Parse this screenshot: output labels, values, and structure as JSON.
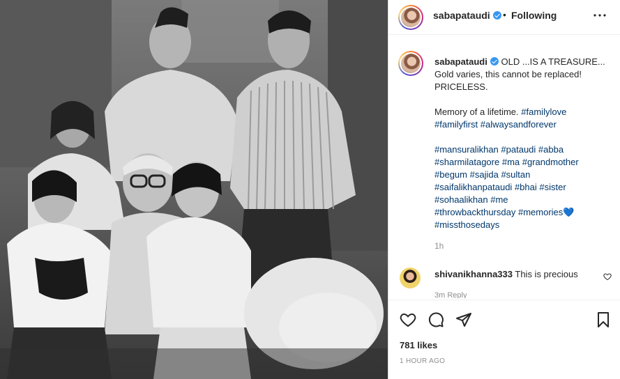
{
  "header": {
    "username": "sabapataudi",
    "separator": "•",
    "follow_status": "Following",
    "more_label": "•••"
  },
  "caption": {
    "username": "sabapataudi",
    "line1_rest": "OLD ...IS A TREASURE...",
    "line2": "Gold varies, this cannot be replaced!",
    "line3": "PRICELESS.",
    "line4_text": "Memory of a lifetime.",
    "tags_line4": [
      "#familylove"
    ],
    "tags_line5": [
      "#familyfirst",
      "#alwaysandforever"
    ],
    "tags_line6": [
      "#mansuralikhan",
      "#pataudi",
      "#abba"
    ],
    "tags_line7": [
      "#sharmilatagore",
      "#ma",
      "#grandmother"
    ],
    "tags_line8": [
      "#begum",
      "#sajida",
      "#sultan"
    ],
    "tags_line9": [
      "#saifalikhanpataudi",
      "#bhai",
      "#sister"
    ],
    "tags_line10": [
      "#sohaalikhan",
      "#me"
    ],
    "tags_line11": [
      "#throwbackthursday",
      "#memories"
    ],
    "heart": "💙",
    "tags_line12": [
      "#missthosedays"
    ],
    "time": "1h"
  },
  "comment": {
    "username": "shivanikhanna333",
    "text": "This is precious",
    "meta": "3m   Reply"
  },
  "actions": {
    "likes": "781 likes",
    "posted": "1 HOUR AGO"
  },
  "icons": {
    "like": "heart-icon",
    "comment": "comment-icon",
    "share": "send-icon",
    "save": "bookmark-icon",
    "verified": "verified-badge-icon"
  },
  "colors": {
    "hashtag": "#00376b",
    "verified": "#3897f0",
    "muted": "#8e8e8e"
  }
}
